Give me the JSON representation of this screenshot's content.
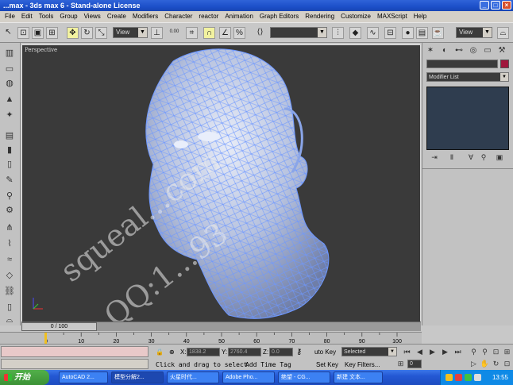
{
  "title": "...max - 3ds max 6 - Stand-alone License",
  "window_controls": {
    "min": "_",
    "max": "□",
    "close": "×"
  },
  "menu": [
    "File",
    "Edit",
    "Tools",
    "Group",
    "Views",
    "Create",
    "Modifiers",
    "Character",
    "reactor",
    "Animation",
    "Graph Editors",
    "Rendering",
    "Customize",
    "MAXScript",
    "Help"
  ],
  "toolbar": {
    "view_dropdown": "View",
    "view_dropdown_2": "View",
    "spinner_label": "0.00"
  },
  "viewport": {
    "label": "Perspective"
  },
  "watermark": {
    "line1": "squeal...com",
    "line2": "QQ:1...93"
  },
  "command_panel": {
    "modifier_list": "Modifier List"
  },
  "timeline": {
    "slider_text": "0 / 100",
    "ticks": [
      "0",
      "10",
      "20",
      "30",
      "40",
      "50",
      "60",
      "70",
      "80",
      "90",
      "100"
    ]
  },
  "status": {
    "x_label": "X:",
    "x_value": "1838.2",
    "y_label": "Y:",
    "y_value": "2760.4",
    "z_label": "Z:",
    "z_value": "0.0",
    "prompt": "Click and drag to select",
    "add_time_tag": "Add Time Tag",
    "auto_key": "uto Key",
    "set_key": "Set Key",
    "selected": "Selected",
    "key_filters": "Key Filters...",
    "frame": "0"
  },
  "taskbar": {
    "start": "开始",
    "tasks": [
      "AutoCAD 2...",
      "模型分解2...",
      "火星时代...",
      "Adobe Pho...",
      "绝望 - CG...",
      "新建 文本..."
    ],
    "clock": "13:55"
  },
  "colors": {
    "accent": "#1c4fc9",
    "object_color": "#a0163c",
    "viewport_bg": "#3a3a3a",
    "mesh": "#7fa6ff"
  }
}
